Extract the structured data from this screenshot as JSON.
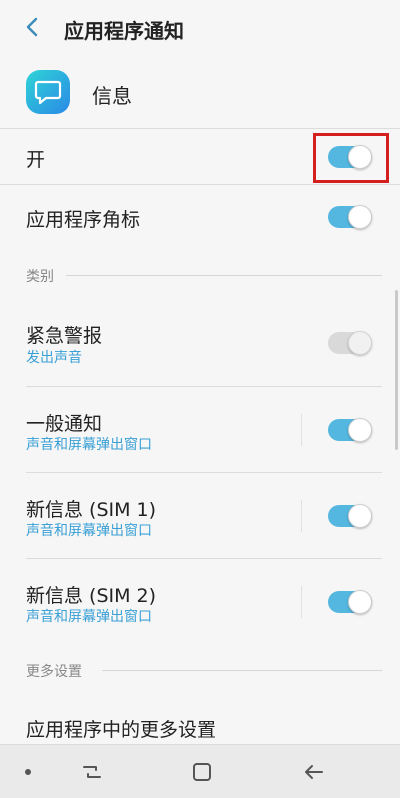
{
  "header": {
    "title": "应用程序通知"
  },
  "app": {
    "name": "信息"
  },
  "master": {
    "label": "开",
    "on": true
  },
  "badge": {
    "label": "应用程序角标",
    "on": true
  },
  "categories": {
    "heading": "类别",
    "items": [
      {
        "label": "紧急警报",
        "sub": "发出声音",
        "on": true,
        "disabled": true
      },
      {
        "label": "一般通知",
        "sub": "声音和屏幕弹出窗口",
        "on": true,
        "disabled": false
      },
      {
        "label": "新信息 (SIM 1)",
        "sub": "声音和屏幕弹出窗口",
        "on": true,
        "disabled": false
      },
      {
        "label": "新信息 (SIM 2)",
        "sub": "声音和屏幕弹出窗口",
        "on": true,
        "disabled": false
      }
    ]
  },
  "more": {
    "heading": "更多设置",
    "item_label": "应用程序中的更多设置"
  },
  "colors": {
    "accent": "#54b7e0",
    "sub_text": "#3aa0d6",
    "highlight": "#d41f1f"
  }
}
